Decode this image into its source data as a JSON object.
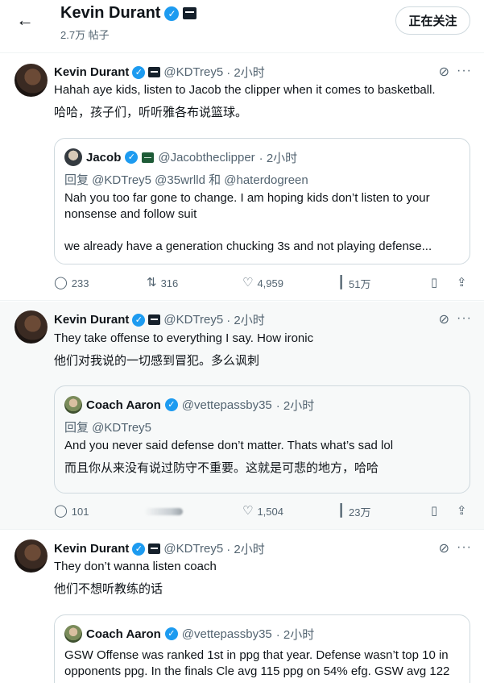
{
  "header": {
    "back_icon": "arrow-left-icon",
    "name": "Kevin Durant",
    "posts_count": "2.7万 帖子",
    "follow_label": "正在关注"
  },
  "tweets": [
    {
      "name": "Kevin Durant",
      "handle": "@KDTrey5",
      "time": "· 2小时",
      "text": "Hahah aye kids, listen to Jacob the clipper when it comes to basketball.",
      "translation": "哈哈，孩子们，听听雅各布说篮球。",
      "quote": {
        "name": "Jacob",
        "handle": "@Jacobtheclipper",
        "time": "· 2小时",
        "reply": "回复 @KDTrey5 @35wrlld 和 @haterdogreen",
        "text1": "Nah you too far gone to change.  I am hoping kids don’t listen to your nonsense and follow suit",
        "text2": "we already have a generation chucking 3s and not playing defense..."
      },
      "replies": "233",
      "retweets": "316",
      "likes": "4,959",
      "views": "51万"
    },
    {
      "name": "Kevin Durant",
      "handle": "@KDTrey5",
      "time": "· 2小时",
      "text": "They take offense to everything I say. How ironic",
      "translation": "他们对我说的一切感到冒犯。多么讽刺",
      "quote": {
        "name": "Coach Aaron",
        "handle": "@vettepassby35",
        "time": "· 2小时",
        "reply": "回复 @KDTrey5",
        "text1": "And you never said defense don’t matter. Thats what’s sad lol",
        "text2": "而且你从来没有说过防守不重要。这就是可悲的地方，哈哈"
      },
      "replies": "101",
      "likes": "1,504",
      "views": "23万"
    },
    {
      "name": "Kevin Durant",
      "handle": "@KDTrey5",
      "time": "· 2小时",
      "text": "They don’t wanna listen coach",
      "translation": "他们不想听教练的话",
      "quote": {
        "name": "Coach Aaron",
        "handle": "@vettepassby35",
        "time": "· 2小时",
        "text1": "GSW Offense was ranked 1st in ppg that year. Defense wasn’t top 10 in opponents ppg. In the finals Cle avg 115 ppg on 54% efg. GSW avg 122 ..."
      }
    }
  ]
}
